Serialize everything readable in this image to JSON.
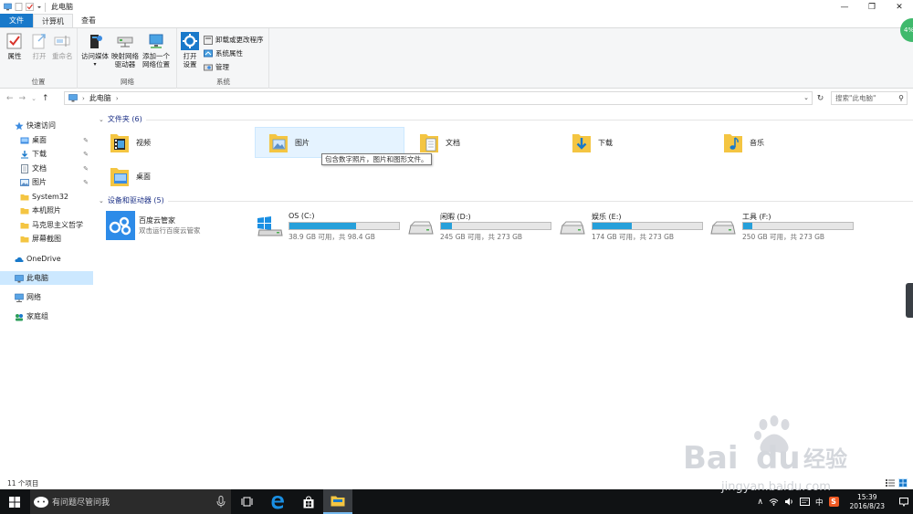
{
  "window": {
    "title": "此电脑"
  },
  "controls": {
    "minimize": "—",
    "maximize": "❐",
    "close": "✕"
  },
  "tabs": {
    "file": "文件",
    "computer": "计算机",
    "view": "查看"
  },
  "ribbon": {
    "location": {
      "label": "位置",
      "properties": "属性",
      "open": "打开",
      "rename": "重命名"
    },
    "network": {
      "label": "网络",
      "access_media": "访问媒体",
      "map_drive_line1": "映射网络",
      "map_drive_line2": "驱动器",
      "add_location_line1": "添加一个",
      "add_location_line2": "网络位置"
    },
    "system": {
      "label": "系统",
      "open_settings_line1": "打开",
      "open_settings_line2": "设置",
      "uninstall": "卸载或更改程序",
      "system_properties": "系统属性",
      "manage": "管理"
    }
  },
  "address": {
    "crumb": "此电脑",
    "search_placeholder": "搜索\"此电脑\""
  },
  "sidebar": {
    "quick_access": "快速访问",
    "items": [
      {
        "label": "桌面",
        "pinned": "✎"
      },
      {
        "label": "下载",
        "pinned": "✎"
      },
      {
        "label": "文档",
        "pinned": "✎"
      },
      {
        "label": "图片",
        "pinned": "✎"
      },
      {
        "label": "System32"
      },
      {
        "label": "本机照片"
      },
      {
        "label": "马克思主义哲学"
      },
      {
        "label": "屏幕截图"
      }
    ],
    "onedrive": "OneDrive",
    "this_pc": "此电脑",
    "network": "网络",
    "homegroup": "家庭组"
  },
  "folders": {
    "header": "文件夹 (6)",
    "items": [
      {
        "label": "视频"
      },
      {
        "label": "图片"
      },
      {
        "label": "文档"
      },
      {
        "label": "下载"
      },
      {
        "label": "音乐"
      },
      {
        "label": "桌面"
      }
    ],
    "tooltip": "包含数字照片，图片和图形文件。"
  },
  "devices": {
    "header": "设备和驱动器 (5)",
    "app": {
      "name": "百度云管家",
      "subtitle": "双击运行百度云管家"
    },
    "drives": [
      {
        "name": "OS (C:)",
        "free": "38.9 GB 可用，共 98.4 GB",
        "used_fraction": 0.605
      },
      {
        "name": "闲暇 (D:)",
        "free": "245 GB 可用，共 273 GB",
        "used_fraction": 0.1
      },
      {
        "name": "娱乐 (E:)",
        "free": "174 GB 可用，共 273 GB",
        "used_fraction": 0.36
      },
      {
        "name": "工具 (F:)",
        "free": "250 GB 可用，共 273 GB",
        "used_fraction": 0.085
      }
    ]
  },
  "status": {
    "count": "11 个项目"
  },
  "taskbar": {
    "search_placeholder": "有问题尽管问我",
    "time": "15:39",
    "date": "2016/8/23",
    "ime": "中",
    "tray_icon_s": "S"
  },
  "badge": {
    "text": "4%"
  },
  "watermark": {
    "brand": "Bai",
    "brand2": "du",
    "brand3": "经验",
    "url": "jingyan.baidu.com"
  },
  "colors": {
    "accent": "#1979ca",
    "drive_fill": "#26a0da",
    "selected": "#cce8ff",
    "section_header": "#1e3287"
  }
}
